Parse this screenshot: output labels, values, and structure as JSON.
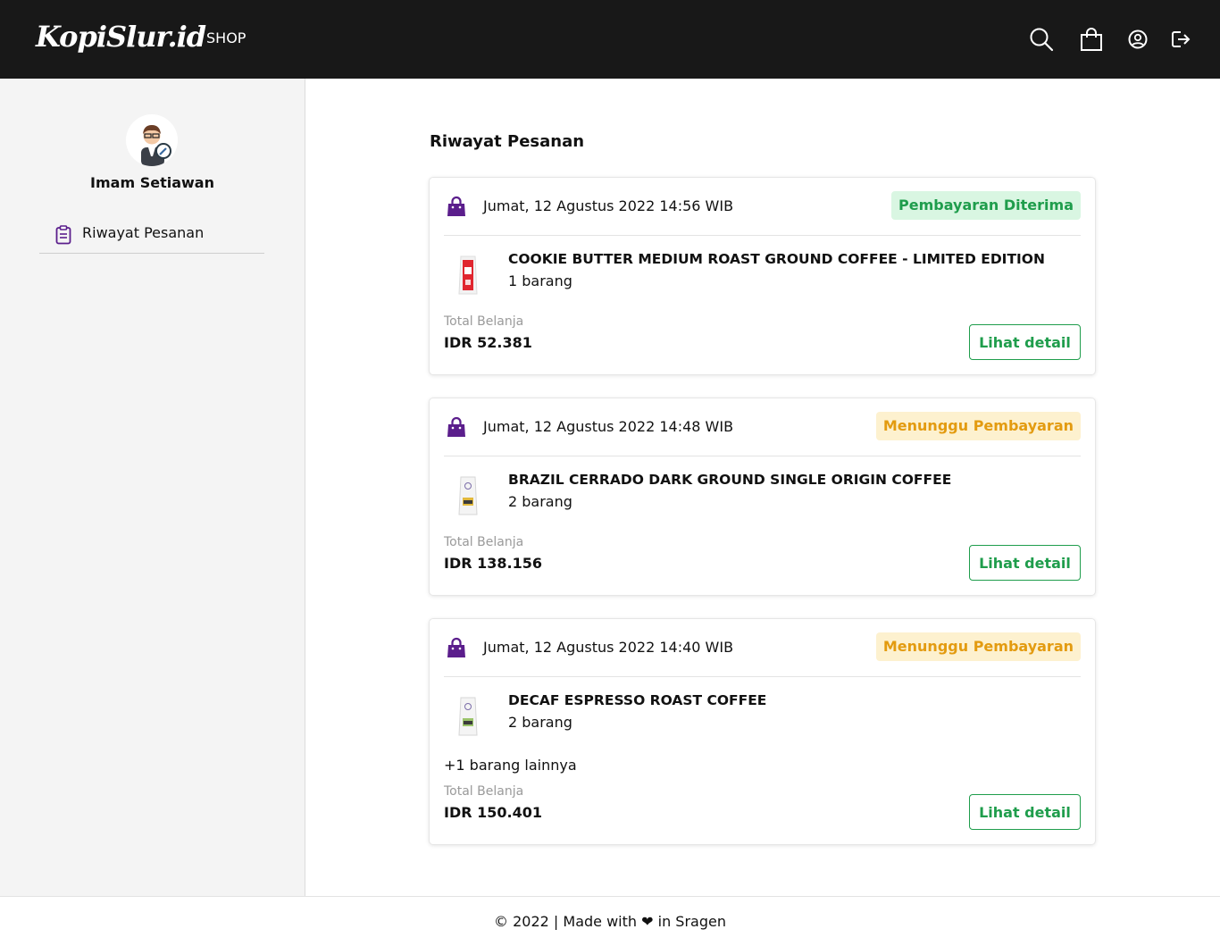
{
  "header": {
    "logo": "KopiSlur.id",
    "nav_shop": "SHOP",
    "icons": [
      "search-icon",
      "cart-icon",
      "account-icon",
      "logout-icon"
    ]
  },
  "sidebar": {
    "user_name": "Imam Setiawan",
    "items": [
      {
        "label": "Riwayat Pesanan",
        "icon": "clipboard-icon"
      }
    ]
  },
  "main": {
    "title": "Riwayat Pesanan",
    "total_label": "Total Belanja",
    "detail_label": "Lihat detail",
    "orders": [
      {
        "date": "Jumat, 12 Agustus 2022 14:56 WIB",
        "status": "Pembayaran Diterima",
        "product": "COOKIE BUTTER MEDIUM ROAST GROUND COFFEE - LIMITED EDITION",
        "qty": "1 barang",
        "more": "",
        "total": "IDR 52.381"
      },
      {
        "date": "Jumat, 12 Agustus 2022 14:48 WIB",
        "status": "Menunggu Pembayaran",
        "product": "BRAZIL CERRADO DARK GROUND SINGLE ORIGIN COFFEE",
        "qty": "2 barang",
        "more": "",
        "total": "IDR 138.156"
      },
      {
        "date": "Jumat, 12 Agustus 2022 14:40 WIB",
        "status": "Menunggu Pembayaran",
        "product": "DECAF ESPRESSO ROAST COFFEE",
        "qty": "2 barang",
        "more": "+1 barang lainnya",
        "total": "IDR 150.401"
      }
    ]
  },
  "footer": {
    "text": "© 2022 | Made with ❤ in Sragen"
  },
  "colors": {
    "navbar": "#181818",
    "accent_green": "#1f9d4c",
    "status_ok_bg": "#d9f6e2",
    "status_wait_text": "#e39b10",
    "status_wait_bg": "#fdf1cf",
    "brand_purple": "#5b1e8c"
  }
}
